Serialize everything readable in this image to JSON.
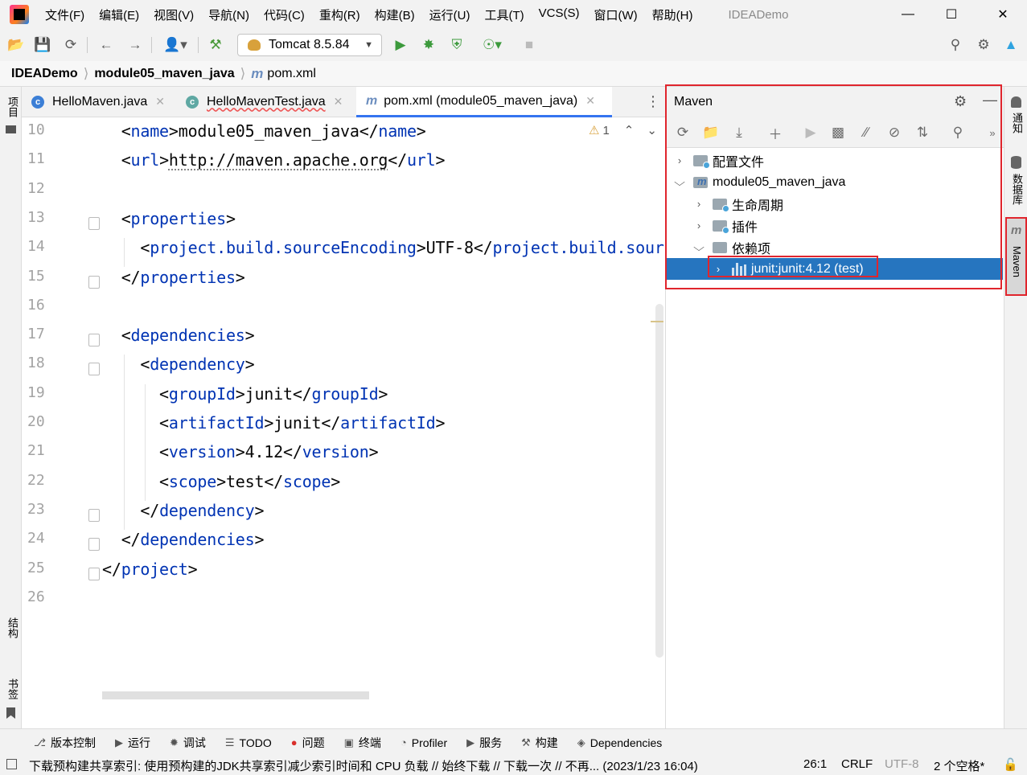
{
  "menu": {
    "items": [
      "文件(F)",
      "编辑(E)",
      "视图(V)",
      "导航(N)",
      "代码(C)",
      "重构(R)",
      "构建(B)",
      "运行(U)",
      "工具(T)",
      "VCS(S)",
      "窗口(W)",
      "帮助(H)"
    ],
    "app_title": "IDEADemo"
  },
  "toolbar": {
    "run_config": "Tomcat 8.5.84"
  },
  "breadcrumb": {
    "project": "IDEADemo",
    "module": "module05_maven_java",
    "file": "pom.xml"
  },
  "left_stripe": {
    "project": "项目",
    "structure": "结构",
    "bookmarks": "书签"
  },
  "editor_tabs": [
    {
      "label": "HelloMaven.java"
    },
    {
      "label": "HelloMavenTest.java"
    },
    {
      "label": "pom.xml (module05_maven_java)"
    }
  ],
  "editor": {
    "warning_count": "1",
    "line_numbers": [
      "10",
      "11",
      "12",
      "13",
      "14",
      "15",
      "16",
      "17",
      "18",
      "19",
      "20",
      "21",
      "22",
      "23",
      "24",
      "25",
      "26"
    ],
    "lines": [
      {
        "indent": "  ",
        "open": "name",
        "text": "module05_maven_java",
        "close": "name"
      },
      {
        "indent": "  ",
        "open": "url",
        "text": "http://maven.apache.org",
        "close": "url"
      },
      {
        "indent": "",
        "open": "",
        "text": "",
        "close": ""
      },
      {
        "indent": "  ",
        "open": "properties",
        "text": "",
        "close": ""
      },
      {
        "indent": "    ",
        "open": "project.build.sourceEncoding",
        "text": "UTF-8",
        "close": "project.build.sourceEncoding"
      },
      {
        "indent": "  ",
        "open": "",
        "text": "",
        "close": "properties"
      },
      {
        "indent": "",
        "open": "",
        "text": "",
        "close": ""
      },
      {
        "indent": "  ",
        "open": "dependencies",
        "text": "",
        "close": ""
      },
      {
        "indent": "    ",
        "open": "dependency",
        "text": "",
        "close": ""
      },
      {
        "indent": "      ",
        "open": "groupId",
        "text": "junit",
        "close": "groupId"
      },
      {
        "indent": "      ",
        "open": "artifactId",
        "text": "junit",
        "close": "artifactId"
      },
      {
        "indent": "      ",
        "open": "version",
        "text": "4.12",
        "close": "version"
      },
      {
        "indent": "      ",
        "open": "scope",
        "text": "test",
        "close": "scope"
      },
      {
        "indent": "    ",
        "open": "",
        "text": "",
        "close": "dependency"
      },
      {
        "indent": "  ",
        "open": "",
        "text": "",
        "close": "dependencies"
      },
      {
        "indent": "",
        "open": "",
        "text": "",
        "close": "project"
      },
      {
        "indent": "",
        "open": "",
        "text": "",
        "close": ""
      }
    ]
  },
  "maven": {
    "title": "Maven",
    "tree": [
      {
        "label": "配置文件",
        "level": 0,
        "expanded": false
      },
      {
        "label": "module05_maven_java",
        "level": 0,
        "expanded": true
      },
      {
        "label": "生命周期",
        "level": 1,
        "expanded": false
      },
      {
        "label": "插件",
        "level": 1,
        "expanded": false
      },
      {
        "label": "依赖项",
        "level": 1,
        "expanded": true
      },
      {
        "label": "junit:junit:4.12 (test)",
        "level": 2,
        "expanded": false,
        "selected": true
      }
    ]
  },
  "right_stripe": {
    "notifications": "通知",
    "database": "数据库",
    "maven": "Maven"
  },
  "bottom_tools": [
    "版本控制",
    "运行",
    "调试",
    "TODO",
    "问题",
    "终端",
    "Profiler",
    "服务",
    "构建",
    "Dependencies"
  ],
  "status": {
    "message": "下载预构建共享索引: 使用预构建的JDK共享索引减少索引时间和 CPU 负载 // 始终下载 // 下载一次 // 不再... (2023/1/23 16:04)",
    "position": "26:1",
    "line_sep": "CRLF",
    "encoding": "UTF-8",
    "indent": "2 个空格*"
  },
  "colors": {
    "selection": "#2675bf",
    "highlight_box": "#e0252d",
    "xml_tag": "#0033b3"
  }
}
